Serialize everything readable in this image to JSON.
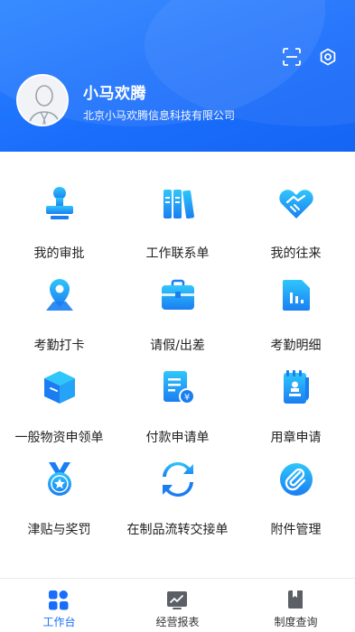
{
  "header": {
    "user_name": "小马欢腾",
    "company": "北京小马欢腾信息科技有限公司",
    "scan_icon": "scan-icon",
    "settings_icon": "settings-icon"
  },
  "colors": {
    "primary": "#1a6dfb",
    "header_gradient_start": "#2a83ff",
    "icon_blue": "#2b8cf5",
    "icon_cyan": "#27c1f5"
  },
  "menu": [
    {
      "label": "我的审批",
      "icon": "stamp-icon"
    },
    {
      "label": "工作联系单",
      "icon": "binders-icon"
    },
    {
      "label": "我的往来",
      "icon": "handshake-icon"
    },
    {
      "label": "考勤打卡",
      "icon": "location-pin-icon"
    },
    {
      "label": "请假/出差",
      "icon": "briefcase-icon"
    },
    {
      "label": "考勤明细",
      "icon": "document-chart-icon"
    },
    {
      "label": "一般物资申领单",
      "icon": "box-icon"
    },
    {
      "label": "付款申请单",
      "icon": "payment-form-icon"
    },
    {
      "label": "用章申请",
      "icon": "seal-notebook-icon"
    },
    {
      "label": "津贴与奖罚",
      "icon": "medal-icon"
    },
    {
      "label": "在制品流转交接单",
      "icon": "refresh-icon"
    },
    {
      "label": "附件管理",
      "icon": "paperclip-icon"
    }
  ],
  "tabbar": [
    {
      "label": "工作台",
      "icon": "workbench-icon",
      "active": true
    },
    {
      "label": "经营报表",
      "icon": "report-chart-icon",
      "active": false
    },
    {
      "label": "制度查询",
      "icon": "rulebook-icon",
      "active": false
    }
  ]
}
